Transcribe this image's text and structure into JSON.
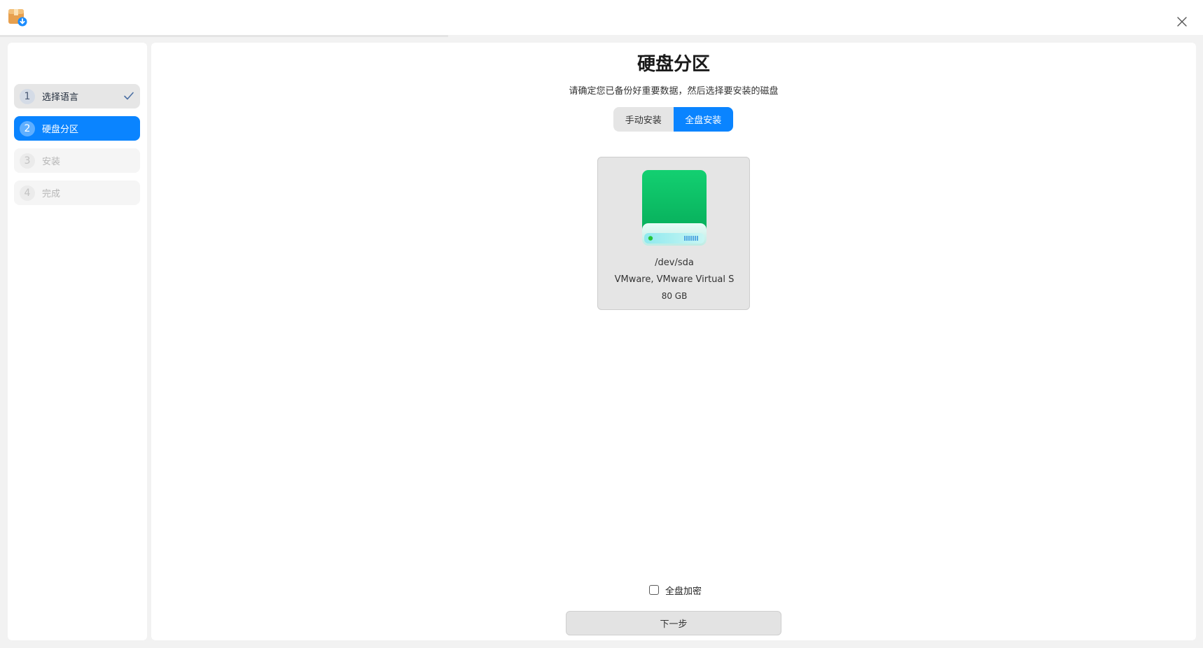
{
  "steps": [
    {
      "number": "1",
      "label": "选择语言",
      "state": "done"
    },
    {
      "number": "2",
      "label": "硬盘分区",
      "state": "active"
    },
    {
      "number": "3",
      "label": "安装",
      "state": "pending"
    },
    {
      "number": "4",
      "label": "完成",
      "state": "pending"
    }
  ],
  "page": {
    "title": "硬盘分区",
    "subtitle": "请确定您已备份好重要数据，然后选择要安装的磁盘"
  },
  "mode_tabs": [
    {
      "label": "手动安装",
      "selected": false
    },
    {
      "label": "全盘安装",
      "selected": true
    }
  ],
  "disk": {
    "path": "/dev/sda",
    "model": "VMware, VMware Virtual S",
    "size": "80 GB",
    "icon": "hard-drive-icon"
  },
  "encrypt": {
    "label": "全盘加密",
    "checked": false
  },
  "next_button": {
    "label": "下一步"
  },
  "colors": {
    "accent": "#0a84ff",
    "drive_green": "#0cc56a"
  }
}
